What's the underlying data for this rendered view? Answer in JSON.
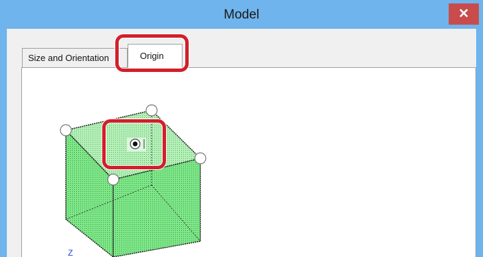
{
  "window": {
    "title": "Model",
    "close_label": "✕"
  },
  "tabs": [
    {
      "label": "Size and Orientation",
      "selected": false
    },
    {
      "label": "Origin",
      "selected": true
    }
  ],
  "diagram": {
    "axis_label": "Z"
  },
  "colors": {
    "titlebar": "#6fb4ec",
    "close_button": "#c94c4c",
    "cube_fill": "#6ee07a",
    "highlight": "#d21f2b"
  }
}
